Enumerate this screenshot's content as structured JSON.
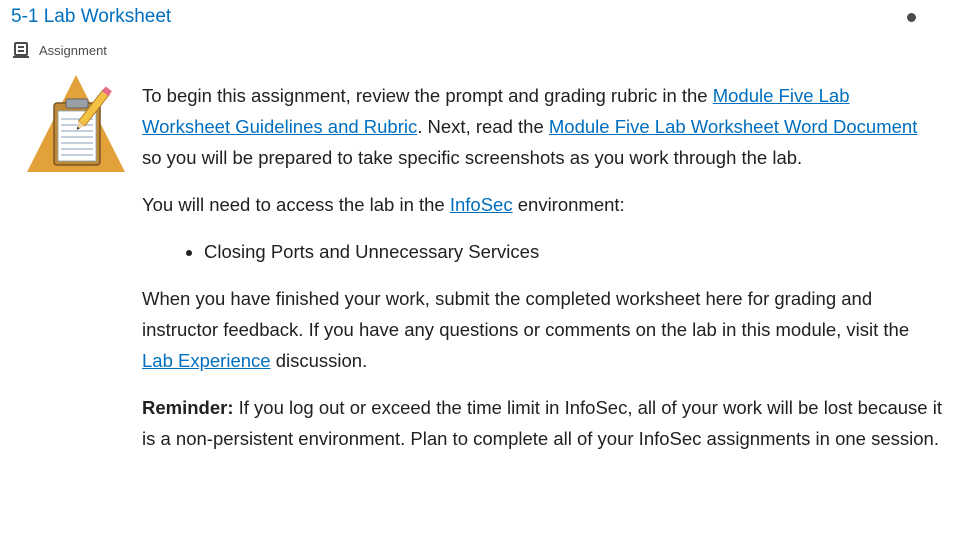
{
  "header": {
    "title": "5-1 Lab Worksheet",
    "type_label": "Assignment"
  },
  "body": {
    "p1_before": "To begin this assignment, review the prompt and grading rubric in the ",
    "p1_link1": "Module Five Lab Worksheet Guidelines and Rubric",
    "p1_middle": ". Next, read the ",
    "p1_link2": "Module Five Lab Worksheet Word Document",
    "p1_after": " so you will be prepared to take specific screenshots as you work through the lab.",
    "p2_before": "You will need to access the lab in the ",
    "p2_link": "InfoSec",
    "p2_after": " environment:",
    "list_items": [
      "Closing Ports and Unnecessary Services"
    ],
    "p3_before": "When you have finished your work, submit the completed worksheet here for grading and instructor feedback. If you have any questions or comments on the lab in this module, visit the ",
    "p3_link": "Lab Experience",
    "p3_after": " discussion.",
    "reminder_label": "Reminder:",
    "reminder_text": " If you log out or exceed the time limit in InfoSec, all of your work will be lost because it is a non-persistent environment. Plan to complete all of your InfoSec assignments in one session."
  },
  "icons": {
    "type_icon": "assignment-icon",
    "thumbnail": "clipboard-pencil-icon",
    "status": "status-dot-icon"
  },
  "colors": {
    "link": "#006fbf",
    "text": "#202122",
    "muted": "#494c4e",
    "thumb_triangle": "#e2a13a"
  }
}
